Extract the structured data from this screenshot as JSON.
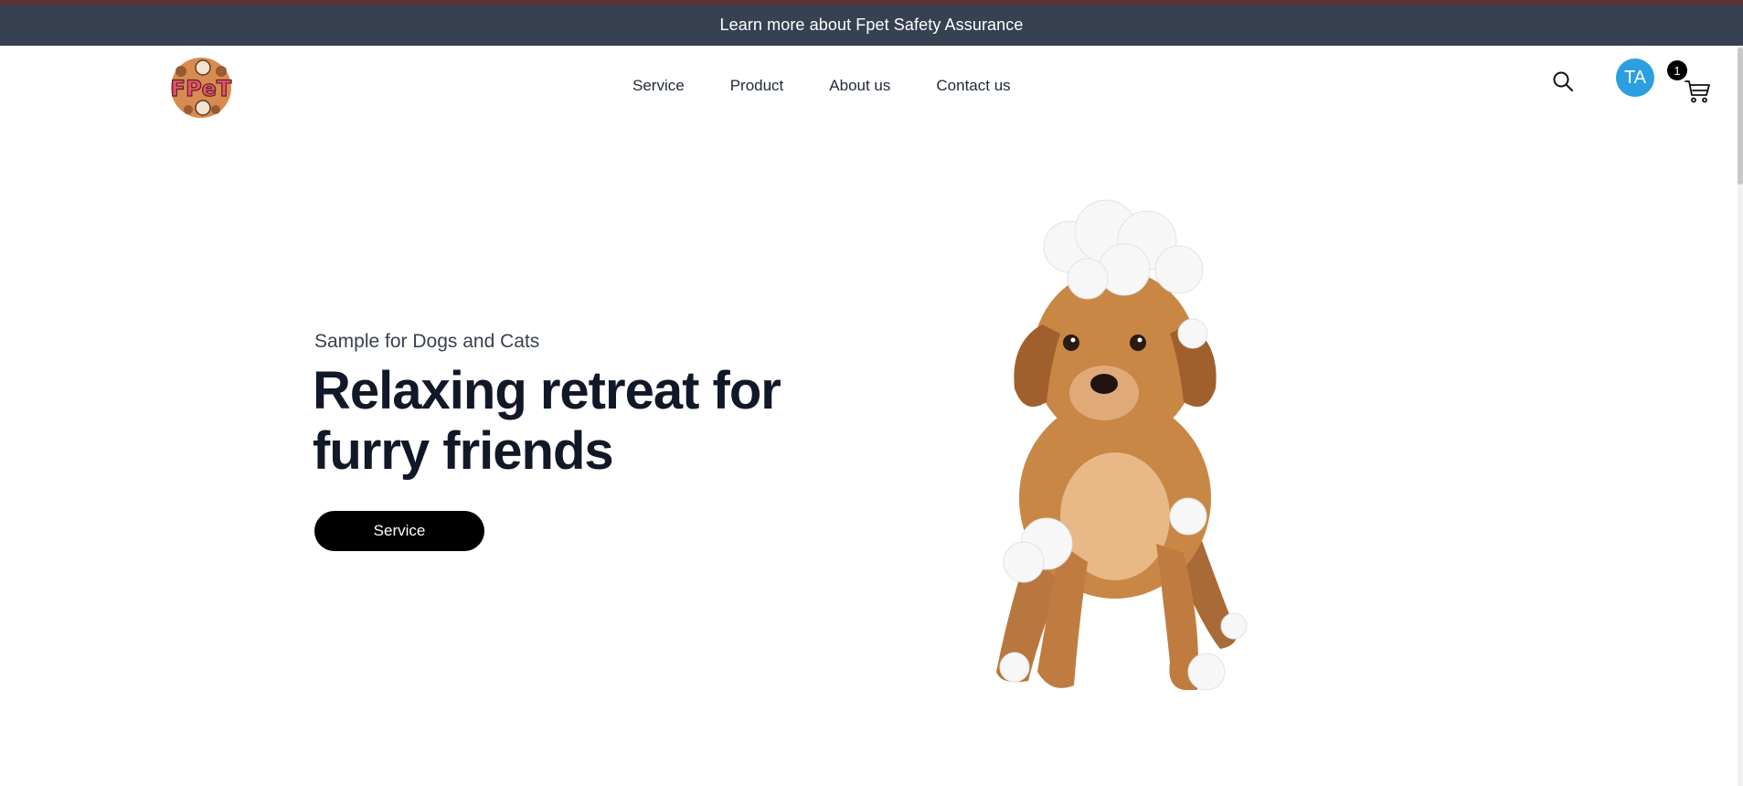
{
  "announcement": {
    "text": "Learn more about Fpet Safety Assurance"
  },
  "logo": {
    "text": "FPeT"
  },
  "nav": {
    "items": [
      {
        "label": "Service"
      },
      {
        "label": "Product"
      },
      {
        "label": "About us"
      },
      {
        "label": "Contact us"
      }
    ]
  },
  "header_actions": {
    "search_icon": "search-icon",
    "avatar_initials": "TA",
    "cart_icon": "cart-icon",
    "cart_count": "1"
  },
  "hero": {
    "kicker": "Sample for Dogs and Cats",
    "title": "Relaxing retreat for furry friends",
    "button_label": "Service",
    "image": "puppy-with-bath-foam"
  },
  "colors": {
    "top_strip": "#5b3334",
    "announcement_bg": "#374151",
    "avatar_bg": "#2b9fe0",
    "button_bg": "#000000",
    "title_text": "#111827"
  }
}
